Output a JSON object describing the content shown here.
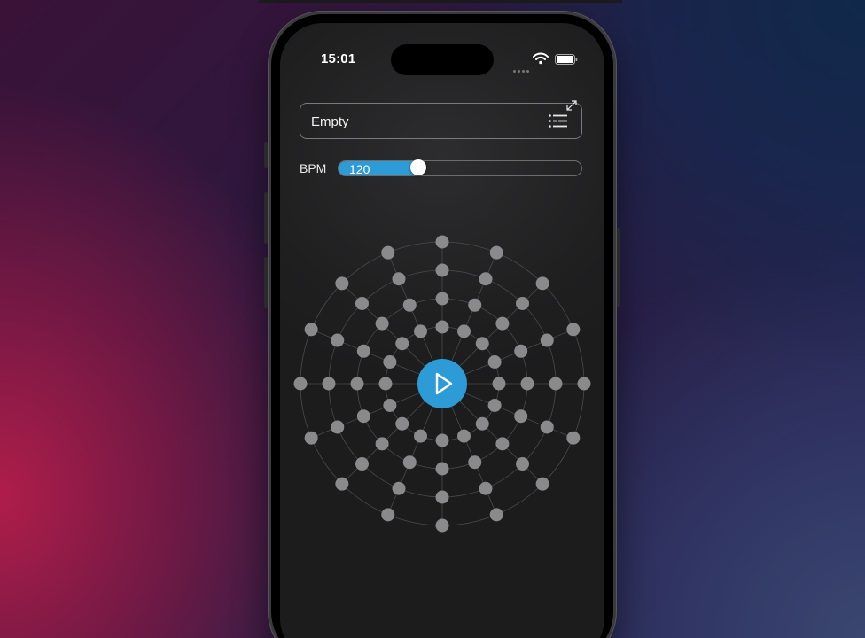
{
  "status_bar": {
    "time": "15:01"
  },
  "preset": {
    "label": "Empty"
  },
  "bpm": {
    "label": "BPM",
    "value": "120",
    "fraction": 0.33
  },
  "sequencer": {
    "rings": 4,
    "steps": 16
  },
  "colors": {
    "accent": "#2d9bd6",
    "step_dot": "#8a8a8c",
    "ring_line": "#4a4a4c"
  },
  "icons": {
    "list": "list-icon",
    "expand": "expand-icon",
    "play": "play-icon",
    "wifi": "wifi-icon",
    "battery": "battery-icon"
  }
}
